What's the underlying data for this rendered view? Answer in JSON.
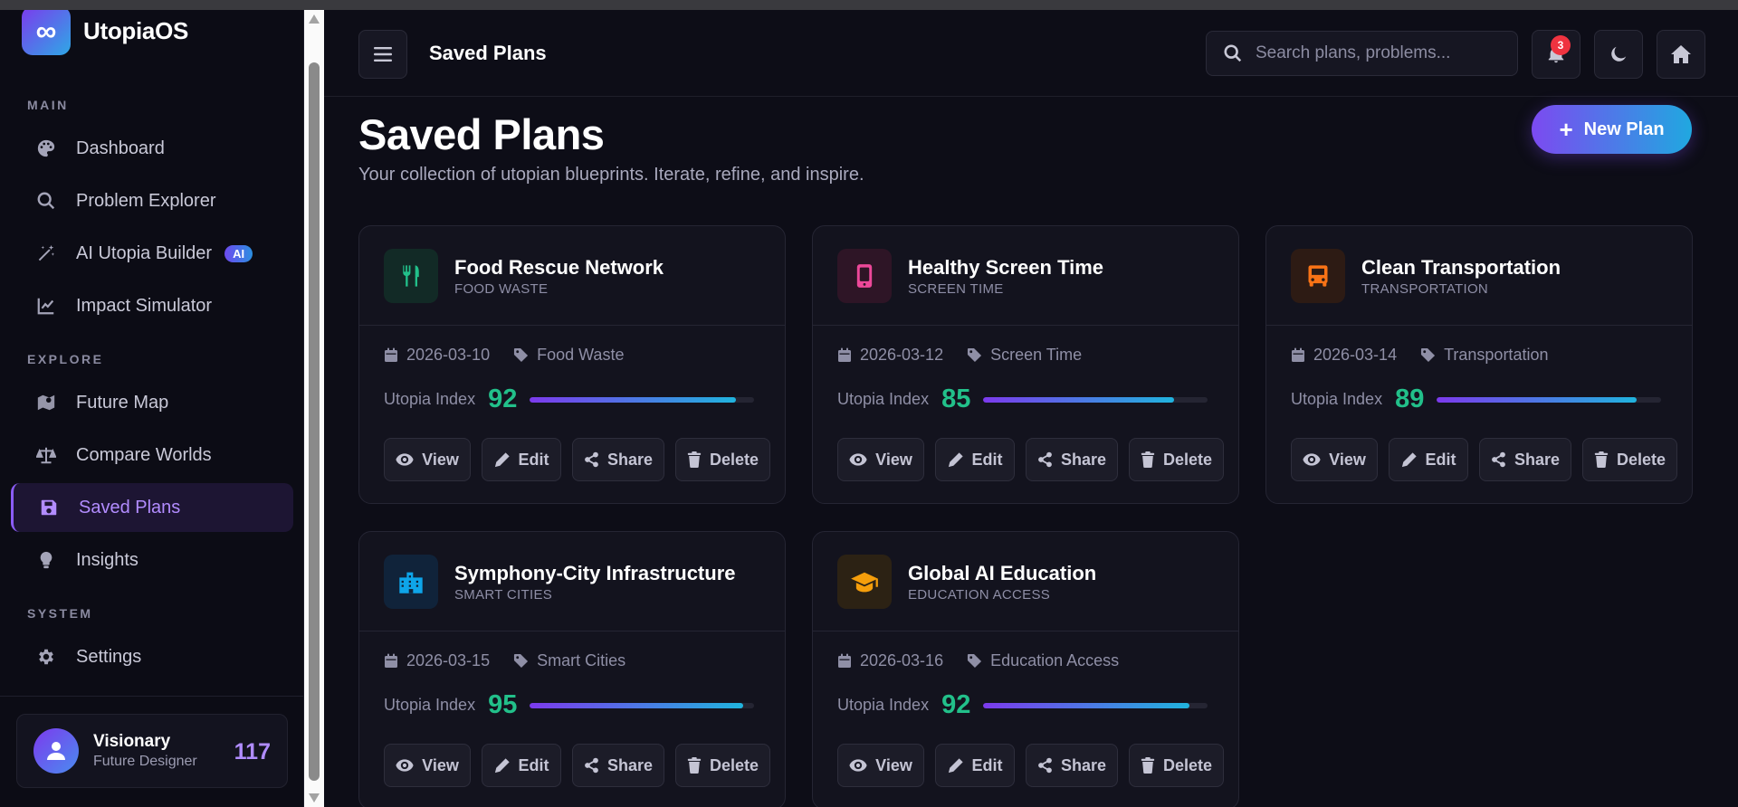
{
  "app": {
    "name": "UtopiaOS"
  },
  "sidebar": {
    "sections": [
      {
        "label": "MAIN"
      },
      {
        "label": "EXPLORE"
      },
      {
        "label": "SYSTEM"
      }
    ],
    "items": [
      {
        "label": "Dashboard",
        "icon": "palette-icon"
      },
      {
        "label": "Problem Explorer",
        "icon": "search-icon"
      },
      {
        "label": "AI Utopia Builder",
        "icon": "magic-wand-icon",
        "badge": "AI"
      },
      {
        "label": "Impact Simulator",
        "icon": "line-chart-icon"
      },
      {
        "label": "Future Map",
        "icon": "map-icon"
      },
      {
        "label": "Compare Worlds",
        "icon": "scale-icon"
      },
      {
        "label": "Saved Plans",
        "icon": "save-icon",
        "active": true
      },
      {
        "label": "Insights",
        "icon": "lightbulb-icon"
      },
      {
        "label": "Settings",
        "icon": "gear-icon"
      }
    ],
    "profile": {
      "name": "Visionary",
      "role": "Future Designer",
      "points": "117"
    }
  },
  "header": {
    "title": "Saved Plans",
    "search_placeholder": "Search plans, problems...",
    "notifications": "3"
  },
  "page": {
    "title": "Saved Plans",
    "subtitle": "Your collection of utopian blueprints. Iterate, refine, and inspire.",
    "new_plan_label": "New Plan",
    "index_label": "Utopia Index",
    "actions": {
      "view": "View",
      "edit": "Edit",
      "share": "Share",
      "delete": "Delete"
    }
  },
  "plans": [
    {
      "title": "Food Rescue Network",
      "category": "FOOD WASTE",
      "date": "2026-03-10",
      "tag": "Food Waste",
      "index": "92",
      "progress": 0.92,
      "icon": "utensils-icon",
      "icon_color": "#22c08a",
      "icon_bg": "#122a26"
    },
    {
      "title": "Healthy Screen Time",
      "category": "SCREEN TIME",
      "date": "2026-03-12",
      "tag": "Screen Time",
      "index": "85",
      "progress": 0.85,
      "icon": "phone-icon",
      "icon_color": "#ec4899",
      "icon_bg": "#2e1526"
    },
    {
      "title": "Clean Transportation",
      "category": "TRANSPORTATION",
      "date": "2026-03-14",
      "tag": "Transportation",
      "index": "89",
      "progress": 0.89,
      "icon": "bus-icon",
      "icon_color": "#f97316",
      "icon_bg": "#2d1b14"
    },
    {
      "title": "Symphony-City Infrastructure",
      "category": "SMART CITIES",
      "date": "2026-03-15",
      "tag": "Smart Cities",
      "index": "95",
      "progress": 0.95,
      "icon": "city-icon",
      "icon_color": "#0ea5e9",
      "icon_bg": "#10233a"
    },
    {
      "title": "Global AI Education",
      "category": "EDUCATION ACCESS",
      "date": "2026-03-16",
      "tag": "Education Access",
      "index": "92",
      "progress": 0.92,
      "icon": "graduation-cap-icon",
      "icon_color": "#f59e0b",
      "icon_bg": "#2c2214"
    }
  ]
}
